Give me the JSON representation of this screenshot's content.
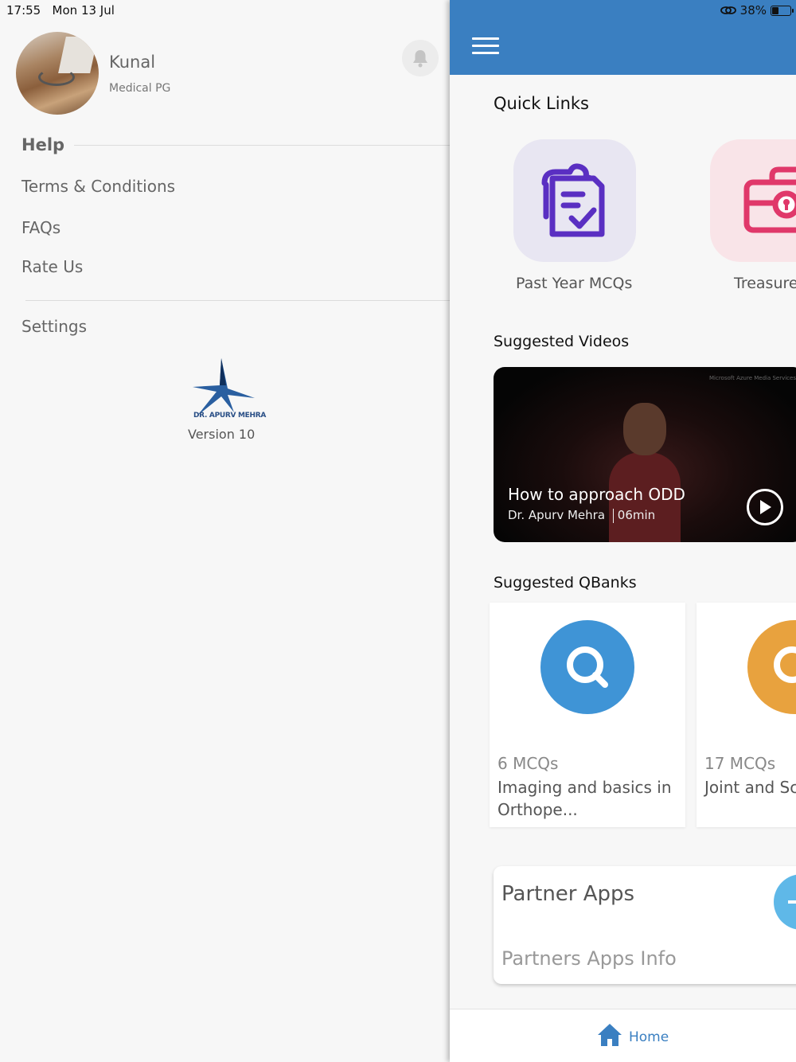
{
  "status_bar": {
    "time": "17:55",
    "date": "Mon 13 Jul",
    "battery_percent": "38%",
    "battery_level": 0.38
  },
  "drawer": {
    "user": {
      "name": "Kunal",
      "subtitle": "Medical PG"
    },
    "help_heading": "Help",
    "help_items": [
      "Terms & Conditions",
      "FAQs",
      "Rate Us"
    ],
    "settings_label": "Settings",
    "logo_text": "DR. APURV MEHRA",
    "version": "Version 10"
  },
  "main": {
    "quick_links_title": "Quick Links",
    "quick_links": [
      {
        "label": "Past Year MCQs",
        "icon": "clipboard-check-icon",
        "bg": "#e8e6f2",
        "color": "#5a2fc2"
      },
      {
        "label": "Treasure",
        "icon": "treasure-chest-icon",
        "bg": "#f9e4e8",
        "color": "#e0386a"
      }
    ],
    "videos_title": "Suggested Videos",
    "video": {
      "title": "How to approach ODD",
      "author": "Dr. Apurv Mehra",
      "duration": "06min",
      "watermark": "Microsoft Azure Media Services"
    },
    "qbanks_title": "Suggested QBanks",
    "qbanks": [
      {
        "count": "6 MCQs",
        "title": "Imaging  and basics in Orthope...",
        "color": "#3f94d6"
      },
      {
        "count": "17 MCQs",
        "title": "Joint and Sc infectio...",
        "color": "#e8a23e"
      }
    ],
    "partner": {
      "title": "Partner Apps",
      "subtitle": "Partners Apps Info"
    },
    "bottom_nav": {
      "home_label": "Home"
    }
  }
}
